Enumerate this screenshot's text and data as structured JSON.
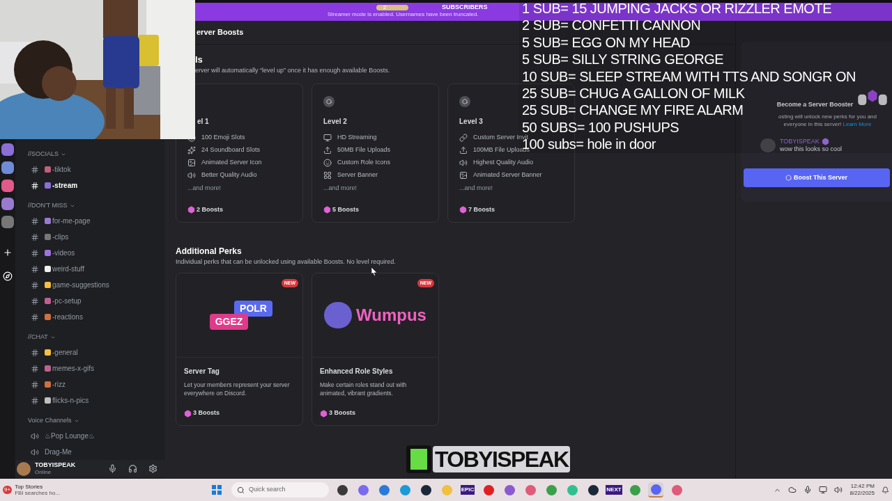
{
  "top_bar": {
    "goal_count": "2",
    "goal_label": "SUBSCRIBERS",
    "notice": "Streamer mode is enabled. Usernames have been truncated."
  },
  "sidebar": {
    "categories": [
      {
        "name": "//SOCIALS",
        "kind": "text",
        "channels": [
          {
            "name": "-tiktok",
            "selected": false
          },
          {
            "name": "-stream",
            "selected": true
          }
        ]
      },
      {
        "name": "//DON'T MISS",
        "kind": "text",
        "channels": [
          {
            "name": "for-me-page",
            "selected": false
          },
          {
            "name": "-clips",
            "selected": false
          },
          {
            "name": "-videos",
            "selected": false
          },
          {
            "name": "weird-stuff",
            "selected": false
          },
          {
            "name": "game-suggestions",
            "selected": false
          },
          {
            "name": "-pc-setup",
            "selected": false
          },
          {
            "name": "-reactions",
            "selected": false
          }
        ]
      },
      {
        "name": "//CHAT",
        "kind": "text",
        "channels": [
          {
            "name": "-general",
            "selected": false
          },
          {
            "name": "memes-x-gifs",
            "selected": false
          },
          {
            "name": "-rizz",
            "selected": false
          },
          {
            "name": "flicks-n-pics",
            "selected": false
          }
        ]
      },
      {
        "name": "Voice Channels",
        "kind": "voice",
        "channels": [
          {
            "name": "♨Pop Lounge♨",
            "selected": false
          },
          {
            "name": "Drag-Me",
            "selected": false
          }
        ]
      }
    ],
    "user": {
      "name": "TOBYISPEAK",
      "status": "Online"
    }
  },
  "main": {
    "title": "erver Boosts",
    "levels_heading": "ls",
    "levels_subtitle": "erver will automatically “level up” once it has enough available Boosts.",
    "levels": [
      {
        "label": "el 1",
        "covered": true,
        "cost": "2 Boosts",
        "more": "...and more!",
        "perks": [
          {
            "kind": "emoji",
            "text": "100 Emoji Slots"
          },
          {
            "kind": "soundboard",
            "text": "24 Soundboard Slots"
          },
          {
            "kind": "gif",
            "text": "Animated Server Icon"
          },
          {
            "kind": "audio",
            "text": "Better Quality Audio"
          }
        ]
      },
      {
        "label": "Level 2",
        "covered": false,
        "cost": "5 Boosts",
        "more": "...and more!",
        "perks": [
          {
            "kind": "stream",
            "text": "HD Streaming"
          },
          {
            "kind": "upload",
            "text": "50MB File Uploads"
          },
          {
            "kind": "face",
            "text": "Custom Role Icons"
          },
          {
            "kind": "grid",
            "text": "Server Banner"
          }
        ]
      },
      {
        "label": "Level 3",
        "covered": false,
        "cost": "7 Boosts",
        "more": "...and more!",
        "perks": [
          {
            "kind": "link",
            "text": "Custom Server Invit"
          },
          {
            "kind": "upload",
            "text": "100MB File Uploads"
          },
          {
            "kind": "audio",
            "text": "Highest Quality Audio"
          },
          {
            "kind": "gif",
            "text": "Animated Server Banner"
          }
        ]
      }
    ],
    "perks_heading": "Additional Perks",
    "perks_subtitle": "Individual perks that can be unlocked using available Boosts. No level required.",
    "perks": [
      {
        "kind": "tags",
        "art_labels": [
          "POLR",
          "GGEZ"
        ],
        "badge": "NEW",
        "title": "Server Tag",
        "description": "Let your members represent your server everywhere on Discord.",
        "cost": "3 Boosts"
      },
      {
        "kind": "role",
        "art_labels": [
          "Wumpus"
        ],
        "badge": "NEW",
        "title": "Enhanced Role Styles",
        "description": "Make certain roles stand out with animated, vibrant gradients.",
        "cost": "3 Boosts"
      }
    ]
  },
  "booster_panel": {
    "title": "Become a Server Booster",
    "description": "osting will unlock new perks for you and everyone in this server!",
    "link": "Learn More",
    "message": {
      "author": "TOBYISPEAK",
      "text": "wow this looks so cool"
    },
    "button": "Boost This Server"
  },
  "sub_goals": [
    "1 SUB= 15 JUMPING JACKS OR RIZZLER EMOTE",
    "2 SUB= CONFETTI CANNON",
    "5 SUB= EGG ON MY HEAD",
    "5 SUB= SILLY STRING GEORGE",
    "10 SUB= SLEEP STREAM WITH TTS AND SONGR ON",
    "25 SUB= CHUG A GALLON OF MILK",
    "25 SUB= CHANGE MY FIRE ALARM",
    "50 SUBS= 100 PUSHUPS",
    "100 subs= hole in door"
  ],
  "logo": "TOBYISPEAK",
  "taskbar": {
    "news": {
      "badge": "9+",
      "title": "Top Stories",
      "subtitle": "FBI searches ho..."
    },
    "search_placeholder": "Quick search",
    "apps": [
      {
        "kind": "files",
        "selected": false
      },
      {
        "kind": "copilot",
        "selected": false
      },
      {
        "kind": "store",
        "selected": false
      },
      {
        "kind": "edge",
        "selected": false
      },
      {
        "kind": "steam",
        "selected": false
      },
      {
        "kind": "folder",
        "selected": false
      },
      {
        "kind": "tile",
        "label": "EPIC",
        "selected": false
      },
      {
        "kind": "opera",
        "selected": false
      },
      {
        "kind": "chat",
        "selected": false
      },
      {
        "kind": "pin",
        "selected": false
      },
      {
        "kind": "chrome",
        "selected": false
      },
      {
        "kind": "camera",
        "selected": false
      },
      {
        "kind": "steam",
        "selected": false
      },
      {
        "kind": "tile",
        "label": "NEXT",
        "selected": false
      },
      {
        "kind": "chrome",
        "selected": false
      },
      {
        "kind": "discord",
        "selected": true
      },
      {
        "kind": "pin",
        "selected": false
      }
    ],
    "time": "12:42 PM",
    "date": "8/22/2025"
  }
}
